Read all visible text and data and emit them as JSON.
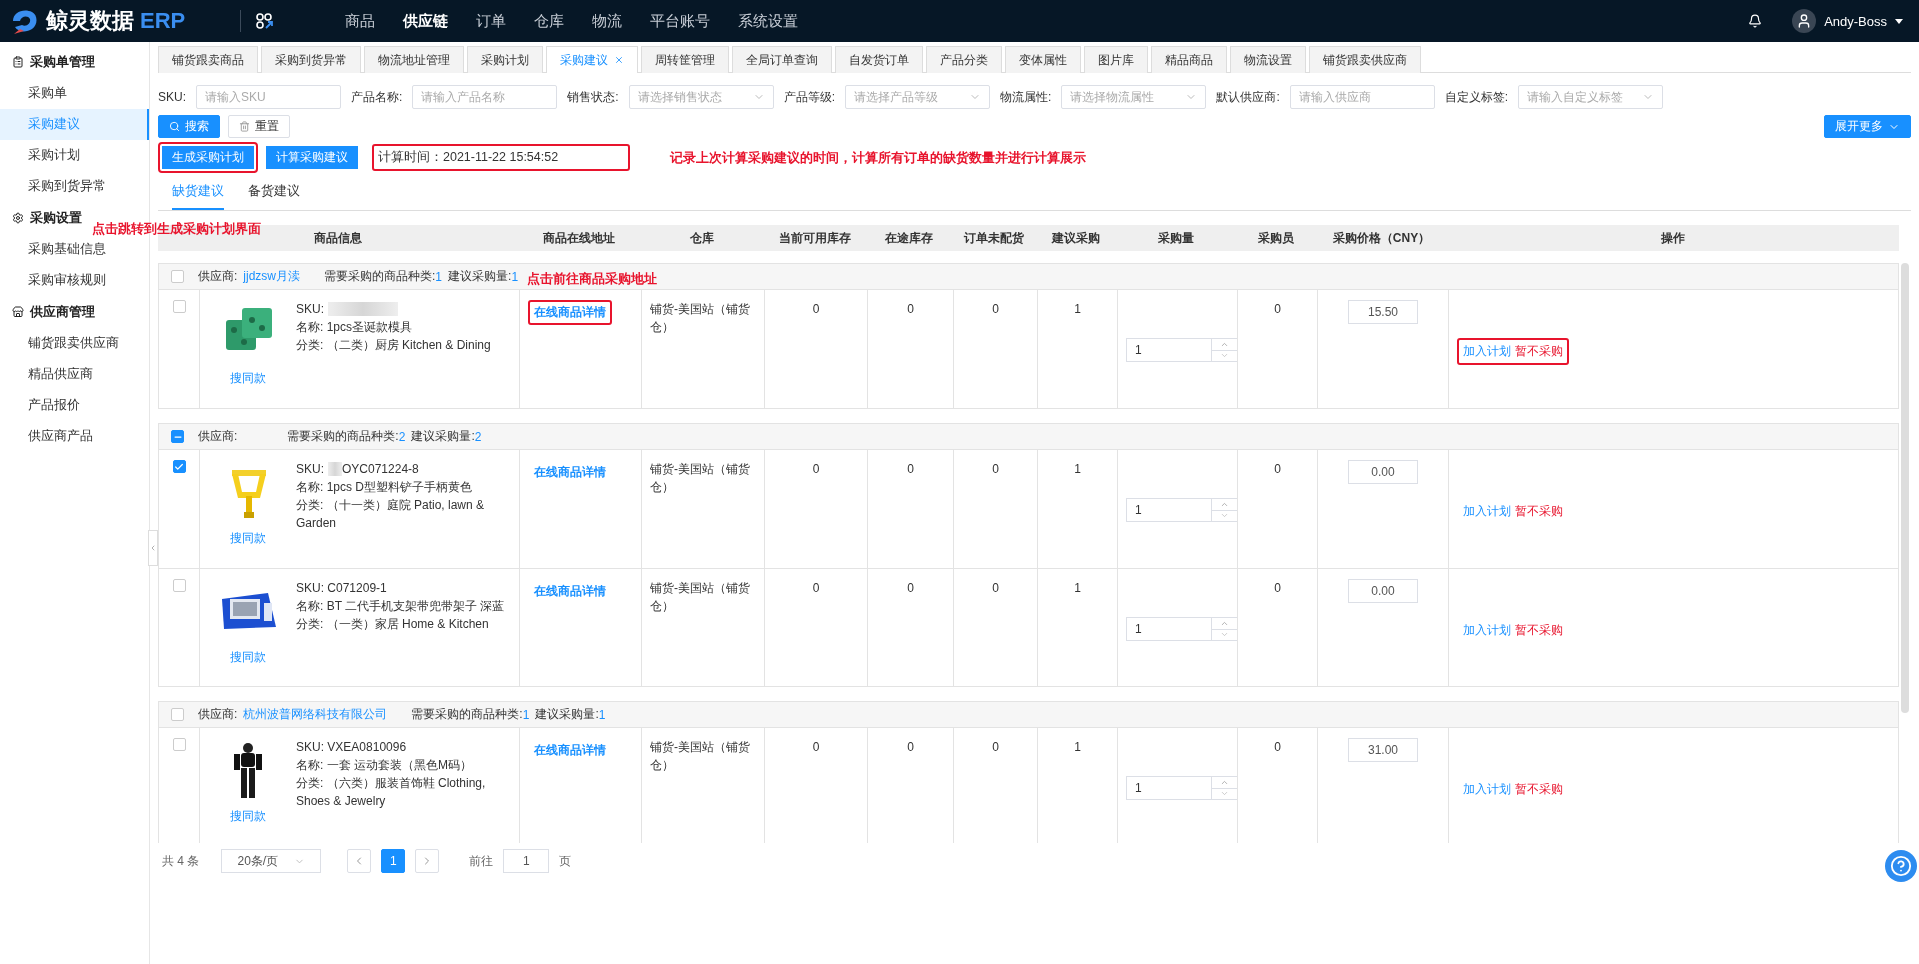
{
  "header": {
    "logo_text": "鲸灵数据",
    "logo_suffix": "ERP",
    "nav": [
      {
        "label": "商品",
        "selected": false
      },
      {
        "label": "供应链",
        "selected": true
      },
      {
        "label": "订单",
        "selected": false
      },
      {
        "label": "仓库",
        "selected": false
      },
      {
        "label": "物流",
        "selected": false
      },
      {
        "label": "平台账号",
        "selected": false
      },
      {
        "label": "系统设置",
        "selected": false
      }
    ],
    "user": "Andy-Boss"
  },
  "sidebar": [
    {
      "title": "采购单管理",
      "items": [
        {
          "label": "采购单",
          "selected": false
        },
        {
          "label": "采购建议",
          "selected": true
        },
        {
          "label": "采购计划",
          "selected": false
        },
        {
          "label": "采购到货异常",
          "selected": false
        }
      ]
    },
    {
      "title": "采购设置",
      "items": [
        {
          "label": "采购基础信息",
          "selected": false
        },
        {
          "label": "采购审核规则",
          "selected": false
        }
      ]
    },
    {
      "title": "供应商管理",
      "items": [
        {
          "label": "铺货跟卖供应商",
          "selected": false
        },
        {
          "label": "精品供应商",
          "selected": false
        },
        {
          "label": "产品报价",
          "selected": false
        },
        {
          "label": "供应商产品",
          "selected": false
        }
      ]
    }
  ],
  "tabs": [
    {
      "label": "铺货跟卖商品",
      "selected": false
    },
    {
      "label": "采购到货异常",
      "selected": false
    },
    {
      "label": "物流地址管理",
      "selected": false
    },
    {
      "label": "采购计划",
      "selected": false
    },
    {
      "label": "采购建议",
      "selected": true
    },
    {
      "label": "周转筐管理",
      "selected": false
    },
    {
      "label": "全局订单查询",
      "selected": false
    },
    {
      "label": "自发货订单",
      "selected": false
    },
    {
      "label": "产品分类",
      "selected": false
    },
    {
      "label": "变体属性",
      "selected": false
    },
    {
      "label": "图片库",
      "selected": false
    },
    {
      "label": "精品商品",
      "selected": false
    },
    {
      "label": "物流设置",
      "selected": false
    },
    {
      "label": "铺货跟卖供应商",
      "selected": false
    }
  ],
  "filters": [
    {
      "label": "SKU:",
      "placeholder": "请输入SKU",
      "kind": "input"
    },
    {
      "label": "产品名称:",
      "placeholder": "请输入产品名称",
      "kind": "input"
    },
    {
      "label": "销售状态:",
      "placeholder": "请选择销售状态",
      "kind": "select"
    },
    {
      "label": "产品等级:",
      "placeholder": "请选择产品等级",
      "kind": "select"
    },
    {
      "label": "物流属性:",
      "placeholder": "请选择物流属性",
      "kind": "select"
    },
    {
      "label": "默认供应商:",
      "placeholder": "请输入供应商",
      "kind": "input"
    },
    {
      "label": "自定义标签:",
      "placeholder": "请输入自定义标签",
      "kind": "select"
    }
  ],
  "search_button": "搜索",
  "reset_button": "重置",
  "expand_button": "展开更多",
  "actions": [
    {
      "label": "生成采购计划",
      "highlighted": true
    },
    {
      "label": "计算采购建议",
      "highlighted": false
    }
  ],
  "calc_time": {
    "text": "计算时间：2021-11-22 15:54:52",
    "highlighted": true
  },
  "annotations": [
    "记录上次计算采购建议的时间，计算所有订单的缺货数量并进行计算展示",
    "点击跳转到生成采购计划界面",
    "点击前往商品采购地址"
  ],
  "sub_tabs": [
    {
      "label": "缺货建议",
      "selected": true
    },
    {
      "label": "备货建议",
      "selected": false
    }
  ],
  "table": {
    "columns": [
      "商品信息",
      "商品在线地址",
      "仓库",
      "当前可用库存",
      "在途库存",
      "订单未配货",
      "建议采购",
      "采购量",
      "采购员",
      "采购价格（CNY）",
      "操作"
    ],
    "groups": [
      {
        "indeterminate": false,
        "supplier_label": "供应商:",
        "supplier": "jjdzsw月渎",
        "kinds_label": "需要采购的商品种类:",
        "kinds": "1",
        "qty_label": "建议采购量:",
        "qty": "1",
        "rows": [
          {
            "checked": false,
            "search_same": "搜同款",
            "sku_label": "SKU:",
            "sku_redacted": true,
            "name": "名称: 1pcs圣诞款模具",
            "category": "分类: （二类）厨房 Kitchen & Dining",
            "link": "在线商品详情",
            "link_highlighted": true,
            "warehouse": "铺货-美国站（铺货仓）",
            "stock": "0",
            "transit": "0",
            "unassigned": "0",
            "suggested": "1",
            "quantity": "1",
            "buyer": "0",
            "price": "15.50",
            "add": "加入计划",
            "skip": "暂不采购",
            "ops_highlighted": true
          }
        ]
      },
      {
        "indeterminate": true,
        "supplier_label": "供应商:",
        "kinds_label": "需要采购的商品种类:",
        "kinds": "2",
        "qty_label": "建议采购量:",
        "qty": "2",
        "rows": [
          {
            "checked": true,
            "search_same": "搜同款",
            "sku_label": "SKU:",
            "sku_redacted": true,
            "sku_value": "OYC071224-8",
            "name": "名称: 1pcs D型塑料铲子手柄黄色",
            "category": "分类: （十一类）庭院 Patio, lawn & Garden",
            "link": "在线商品详情",
            "link_highlighted": false,
            "warehouse": "铺货-美国站（铺货仓）",
            "stock": "0",
            "transit": "0",
            "unassigned": "0",
            "suggested": "1",
            "quantity": "1",
            "buyer": "0",
            "price": "0.00",
            "add": "加入计划",
            "skip": "暂不采购",
            "ops_highlighted": false
          },
          {
            "checked": false,
            "search_same": "搜同款",
            "sku_label": "SKU: C071209-1",
            "sku_redacted": false,
            "name": "名称: BT 二代手机支架带兜带架子 深蓝",
            "category": "分类: （一类）家居 Home & Kitchen",
            "link": "在线商品详情",
            "link_highlighted": false,
            "warehouse": "铺货-美国站（铺货仓）",
            "stock": "0",
            "transit": "0",
            "unassigned": "0",
            "suggested": "1",
            "quantity": "1",
            "buyer": "0",
            "price": "0.00",
            "add": "加入计划",
            "skip": "暂不采购",
            "ops_highlighted": false
          }
        ]
      },
      {
        "indeterminate": false,
        "supplier_label": "供应商:",
        "supplier": "杭州波普网络科技有限公司",
        "kinds_label": "需要采购的商品种类:",
        "kinds": "1",
        "qty_label": "建议采购量:",
        "qty": "1",
        "rows": [
          {
            "checked": false,
            "search_same": "搜同款",
            "sku_label": "SKU: VXEA0810096",
            "sku_redacted": false,
            "name": "名称: 一套 运动套装（黑色M码）",
            "category": "分类: （六类）服装首饰鞋 Clothing, Shoes & Jewelry",
            "link": "在线商品详情",
            "link_highlighted": false,
            "warehouse": "铺货-美国站（铺货仓）",
            "stock": "0",
            "transit": "0",
            "unassigned": "0",
            "suggested": "1",
            "quantity": "1",
            "buyer": "0",
            "price": "31.00",
            "add": "加入计划",
            "skip": "暂不采购",
            "ops_highlighted": false
          }
        ]
      }
    ]
  },
  "pagination": {
    "total": "共 4 条",
    "page_size": "20条/页",
    "pages": [
      {
        "label": "1",
        "selected": true
      }
    ],
    "goto_label": "前往",
    "goto_value": "1",
    "goto_suffix": "页"
  }
}
